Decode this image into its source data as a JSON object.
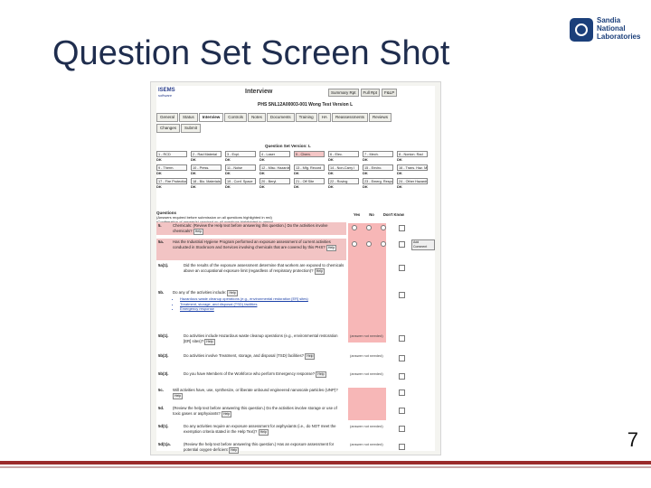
{
  "slide": {
    "title": "Question Set Screen Shot",
    "page_number": "7",
    "logo_text": [
      "Sandia",
      "National",
      "Laboratories"
    ]
  },
  "app": {
    "brand": "ISEMS",
    "brand_sub": "software",
    "window_title": "Interview",
    "record_line": "PHS SNL12A00003-001 Wong Test Version L",
    "top_buttons": [
      "Summary Rpt",
      "Full Rpt",
      "F&LP"
    ],
    "tabs_row1": [
      "General",
      "Status",
      "Interview",
      "Controls",
      "Notes",
      "Documents",
      "Training",
      "HA",
      "Reassessments",
      "Reviews"
    ],
    "tabs_row2": [
      "Changes",
      "Submit"
    ],
    "active_tab": "Interview",
    "question_set_label": "Question Set Version: L",
    "hazards": [
      {
        "label": "1 - RCD",
        "status": "DK"
      },
      {
        "label": "2 - Rad Material",
        "status": "DK"
      },
      {
        "label": "3 - Expl.",
        "status": "DK"
      },
      {
        "label": "4 - Laser",
        "status": "DK"
      },
      {
        "label": "5 - Chem.",
        "status": "",
        "pink": true
      },
      {
        "label": "6 - Elec.",
        "status": "DK"
      },
      {
        "label": "7 - Mech.",
        "status": "DK"
      },
      {
        "label": "8 - Nonion. Rad",
        "status": "DK"
      },
      {
        "label": "9 - Therm.",
        "status": "DK"
      },
      {
        "label": "10 - Press.",
        "status": "DK"
      },
      {
        "label": "11 - Noise",
        "status": "DK"
      },
      {
        "label": "12 - Misc. Hazards",
        "status": "DK"
      },
      {
        "label": "13 - Mfg. Record",
        "status": "DK"
      },
      {
        "label": "14 - Non-Carry I",
        "status": "DK"
      },
      {
        "label": "15 - Enviro.",
        "status": "DK"
      },
      {
        "label": "16 - Trans. Haz. Matter",
        "status": "DK"
      },
      {
        "label": "17 - Fire Protection",
        "status": "DK"
      },
      {
        "label": "18 - Bio. Materials",
        "status": "DK"
      },
      {
        "label": "19 - Conf. Space",
        "status": "DK"
      },
      {
        "label": "20 - Beryl.",
        "status": "DK"
      },
      {
        "label": "21 - Off Site",
        "status": "DK"
      },
      {
        "label": "22 - Roving",
        "status": "DK"
      },
      {
        "label": "23 - Emerg. Response",
        "status": "DK"
      },
      {
        "label": "24 - Other Hazards",
        "status": "DK"
      }
    ],
    "questions_header": "Questions",
    "questions_note1": "(Answers required before submission on all questions highlighted in red)",
    "questions_note2": "(Confirmation of answer(s) required on all questions highlighted in green)",
    "col_yes": "Yes",
    "col_no": "No",
    "col_dk": "Don't Know",
    "help_label": "Help",
    "add_comment": "Add Comment",
    "answer_not_needed": "(answer not needed)",
    "questions": [
      {
        "num": "5.",
        "text": "Chemicals: (Review the Help text before answering this question.) Do the activities involve chemicals?",
        "kind": "radios"
      },
      {
        "num": "5a.",
        "text": "Has the Industrial Hygiene Program performed an exposure assessment of current activities conducted in Stockroom and Services involving chemicals that are covered by this PHS?",
        "kind": "radios"
      },
      {
        "num": "5a(1).",
        "text": "Did the results of the exposure assessment determine that workers are exposed to chemicals above an occupational exposure limit (regardless of respiratory protection)?",
        "kind": "pink"
      },
      {
        "num": "5b.",
        "text": "Do any of the activities include:",
        "kind": "pink",
        "bullets": [
          "Hazardous waste cleanup operations (e.g., environmental restoration [ER] sites)",
          "Treatment, storage, and disposal (TSD) facilities",
          "Emergency response"
        ]
      },
      {
        "num": "5b(1).",
        "text": "Do activities include Hazardous waste cleanup operations (e.g., environmental restoration [ER] sites)?",
        "kind": "nn"
      },
      {
        "num": "5b(2).",
        "text": "Do activities involve Treatment, storage, and disposal (TSD) facilities?",
        "kind": "nn"
      },
      {
        "num": "5b(3).",
        "text": "Do you have Members of the Workforce who perform Emergency response?",
        "kind": "nn"
      },
      {
        "num": "5c.",
        "text": "Will activities have, use, synthesize, or liberate unbound engineered nanoscale particles (UNP)?",
        "kind": "pink2"
      },
      {
        "num": "5d.",
        "text": "(Review the help text before answering this question.) Do the activities involve storage or use of toxic gases or asphyxiants?",
        "kind": "pink2"
      },
      {
        "num": "5d(1).",
        "text": "Do any activities require an exposure assessment for asphyxiants (i.e., do NOT meet the exemption criteria stated in the Help Text)?",
        "kind": "nn"
      },
      {
        "num": "5d(1)a.",
        "text": "(Review the help text before answering this question.) Has an exposure assessment for potential oxygen-deficient",
        "kind": "nn"
      }
    ]
  }
}
